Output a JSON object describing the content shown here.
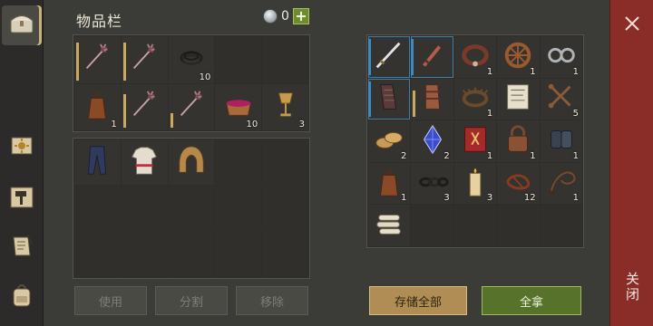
{
  "header": {
    "title": "物品栏",
    "currency_count": "0",
    "add_label": "+"
  },
  "sidebar": {
    "items": [
      {
        "icon": "chest-icon",
        "active": true
      },
      {
        "icon": "sun-book-icon",
        "active": false
      },
      {
        "icon": "hammer-craft-icon",
        "active": false
      },
      {
        "icon": "scroll-quill-icon",
        "active": false
      },
      {
        "icon": "backpack-icon",
        "active": false
      }
    ]
  },
  "inventory": {
    "rows": [
      [
        {
          "icon": "mace-icon",
          "count": "",
          "durability": 1.0
        },
        {
          "icon": "mace-icon",
          "count": "",
          "durability": 1.0
        },
        {
          "icon": "rope-coil-icon",
          "count": "10"
        },
        {
          "icon": "",
          "count": ""
        },
        {
          "icon": "",
          "count": ""
        }
      ],
      [
        {
          "icon": "leather-flask-icon",
          "count": "1"
        },
        {
          "icon": "mace-icon",
          "count": "",
          "durability": 0.9
        },
        {
          "icon": "mace-icon",
          "count": "",
          "durability": 0.4
        },
        {
          "icon": "berry-bowl-icon",
          "count": "10"
        },
        {
          "icon": "goblet-icon",
          "count": "3"
        }
      ]
    ],
    "equip_row": [
      {
        "icon": "trousers-icon"
      },
      {
        "icon": "shirt-icon"
      },
      {
        "icon": "hood-icon"
      },
      {
        "icon": ""
      },
      {
        "icon": ""
      }
    ],
    "buttons": {
      "use": "使用",
      "split": "分割",
      "remove": "移除"
    }
  },
  "storage": {
    "rows": [
      [
        {
          "icon": "longsword-icon",
          "count": "",
          "selected": true
        },
        {
          "icon": "dagger-icon",
          "count": "",
          "selected": true
        },
        {
          "icon": "collar-icon",
          "count": "1"
        },
        {
          "icon": "wooden-wheel-icon",
          "count": "1"
        },
        {
          "icon": "shackles-icon",
          "count": "1"
        }
      ],
      [
        {
          "icon": "leather-gauntlet-icon",
          "count": "",
          "selected": true
        },
        {
          "icon": "leather-bracer-icon",
          "count": "",
          "durability": 0.8
        },
        {
          "icon": "thorn-crown-icon",
          "count": "1"
        },
        {
          "icon": "parchment-map-icon",
          "count": ""
        },
        {
          "icon": "crossed-keys-icon",
          "count": "5"
        }
      ],
      [
        {
          "icon": "bread-pile-icon",
          "count": "2"
        },
        {
          "icon": "sapphire-gem-icon",
          "count": "2"
        },
        {
          "icon": "red-tome-icon",
          "count": "1"
        },
        {
          "icon": "padlock-icon",
          "count": "1"
        },
        {
          "icon": "manacle-icon",
          "count": "1"
        }
      ],
      [
        {
          "icon": "leather-flask-icon",
          "count": "1"
        },
        {
          "icon": "chain-icon",
          "count": "3"
        },
        {
          "icon": "candle-icon",
          "count": "3"
        },
        {
          "icon": "rope-knot-icon",
          "count": "12"
        },
        {
          "icon": "whip-icon",
          "count": "1"
        }
      ],
      [
        {
          "icon": "scroll-bundle-icon",
          "count": ""
        },
        {
          "icon": "",
          "count": ""
        },
        {
          "icon": "",
          "count": ""
        },
        {
          "icon": "",
          "count": ""
        },
        {
          "icon": "",
          "count": ""
        }
      ]
    ],
    "buttons": {
      "store_all": "存储全部",
      "take_all": "全拿"
    }
  },
  "close": {
    "label": "关闭"
  },
  "colors": {
    "accent_green": "#57732b",
    "close_red": "#8a2d29",
    "durability": "#c9a860",
    "selection": "#3f8ac0"
  }
}
